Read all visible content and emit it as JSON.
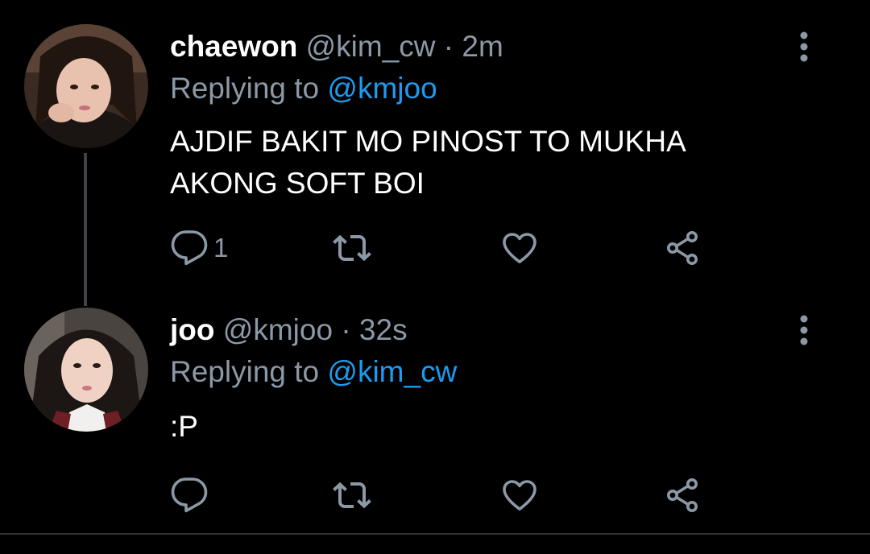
{
  "tweets": [
    {
      "display_name": "chaewon",
      "handle": "@kim_cw",
      "separator": "·",
      "time": "2m",
      "replying_prefix": "Replying to",
      "replying_to": "@kmjoo",
      "text": "AJDIF BAKIT MO PINOST TO MUKHA AKONG SOFT BOI",
      "reply_count": "1",
      "icons": [
        "reply-icon",
        "retweet-icon",
        "like-icon",
        "share-icon",
        "more-vertical-icon"
      ]
    },
    {
      "display_name": "joo",
      "handle": "@kmjoo",
      "separator": "·",
      "time": "32s",
      "replying_prefix": "Replying to",
      "replying_to": "@kim_cw",
      "text": ":P",
      "reply_count": "",
      "icons": [
        "reply-icon",
        "retweet-icon",
        "like-icon",
        "share-icon",
        "more-vertical-icon"
      ]
    }
  ],
  "colors": {
    "background": "#000000",
    "text_primary": "#ffffff",
    "text_secondary": "#8b98a5",
    "link": "#1d9bf0",
    "thread_line": "#3f4347",
    "icon": "#8b98a5"
  }
}
